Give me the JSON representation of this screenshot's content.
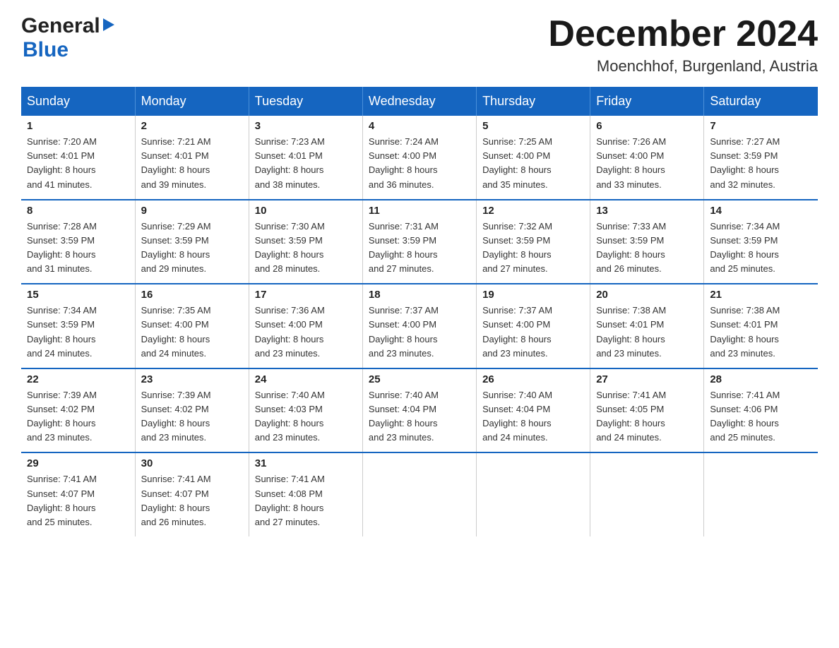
{
  "logo": {
    "line1": "General",
    "triangle": "▶",
    "line2": "Blue"
  },
  "title": "December 2024",
  "subtitle": "Moenchhof, Burgenland, Austria",
  "days_of_week": [
    "Sunday",
    "Monday",
    "Tuesday",
    "Wednesday",
    "Thursday",
    "Friday",
    "Saturday"
  ],
  "weeks": [
    [
      {
        "day": "1",
        "sunrise": "7:20 AM",
        "sunset": "4:01 PM",
        "daylight": "8 hours and 41 minutes."
      },
      {
        "day": "2",
        "sunrise": "7:21 AM",
        "sunset": "4:01 PM",
        "daylight": "8 hours and 39 minutes."
      },
      {
        "day": "3",
        "sunrise": "7:23 AM",
        "sunset": "4:01 PM",
        "daylight": "8 hours and 38 minutes."
      },
      {
        "day": "4",
        "sunrise": "7:24 AM",
        "sunset": "4:00 PM",
        "daylight": "8 hours and 36 minutes."
      },
      {
        "day": "5",
        "sunrise": "7:25 AM",
        "sunset": "4:00 PM",
        "daylight": "8 hours and 35 minutes."
      },
      {
        "day": "6",
        "sunrise": "7:26 AM",
        "sunset": "4:00 PM",
        "daylight": "8 hours and 33 minutes."
      },
      {
        "day": "7",
        "sunrise": "7:27 AM",
        "sunset": "3:59 PM",
        "daylight": "8 hours and 32 minutes."
      }
    ],
    [
      {
        "day": "8",
        "sunrise": "7:28 AM",
        "sunset": "3:59 PM",
        "daylight": "8 hours and 31 minutes."
      },
      {
        "day": "9",
        "sunrise": "7:29 AM",
        "sunset": "3:59 PM",
        "daylight": "8 hours and 29 minutes."
      },
      {
        "day": "10",
        "sunrise": "7:30 AM",
        "sunset": "3:59 PM",
        "daylight": "8 hours and 28 minutes."
      },
      {
        "day": "11",
        "sunrise": "7:31 AM",
        "sunset": "3:59 PM",
        "daylight": "8 hours and 27 minutes."
      },
      {
        "day": "12",
        "sunrise": "7:32 AM",
        "sunset": "3:59 PM",
        "daylight": "8 hours and 27 minutes."
      },
      {
        "day": "13",
        "sunrise": "7:33 AM",
        "sunset": "3:59 PM",
        "daylight": "8 hours and 26 minutes."
      },
      {
        "day": "14",
        "sunrise": "7:34 AM",
        "sunset": "3:59 PM",
        "daylight": "8 hours and 25 minutes."
      }
    ],
    [
      {
        "day": "15",
        "sunrise": "7:34 AM",
        "sunset": "3:59 PM",
        "daylight": "8 hours and 24 minutes."
      },
      {
        "day": "16",
        "sunrise": "7:35 AM",
        "sunset": "4:00 PM",
        "daylight": "8 hours and 24 minutes."
      },
      {
        "day": "17",
        "sunrise": "7:36 AM",
        "sunset": "4:00 PM",
        "daylight": "8 hours and 23 minutes."
      },
      {
        "day": "18",
        "sunrise": "7:37 AM",
        "sunset": "4:00 PM",
        "daylight": "8 hours and 23 minutes."
      },
      {
        "day": "19",
        "sunrise": "7:37 AM",
        "sunset": "4:00 PM",
        "daylight": "8 hours and 23 minutes."
      },
      {
        "day": "20",
        "sunrise": "7:38 AM",
        "sunset": "4:01 PM",
        "daylight": "8 hours and 23 minutes."
      },
      {
        "day": "21",
        "sunrise": "7:38 AM",
        "sunset": "4:01 PM",
        "daylight": "8 hours and 23 minutes."
      }
    ],
    [
      {
        "day": "22",
        "sunrise": "7:39 AM",
        "sunset": "4:02 PM",
        "daylight": "8 hours and 23 minutes."
      },
      {
        "day": "23",
        "sunrise": "7:39 AM",
        "sunset": "4:02 PM",
        "daylight": "8 hours and 23 minutes."
      },
      {
        "day": "24",
        "sunrise": "7:40 AM",
        "sunset": "4:03 PM",
        "daylight": "8 hours and 23 minutes."
      },
      {
        "day": "25",
        "sunrise": "7:40 AM",
        "sunset": "4:04 PM",
        "daylight": "8 hours and 23 minutes."
      },
      {
        "day": "26",
        "sunrise": "7:40 AM",
        "sunset": "4:04 PM",
        "daylight": "8 hours and 24 minutes."
      },
      {
        "day": "27",
        "sunrise": "7:41 AM",
        "sunset": "4:05 PM",
        "daylight": "8 hours and 24 minutes."
      },
      {
        "day": "28",
        "sunrise": "7:41 AM",
        "sunset": "4:06 PM",
        "daylight": "8 hours and 25 minutes."
      }
    ],
    [
      {
        "day": "29",
        "sunrise": "7:41 AM",
        "sunset": "4:07 PM",
        "daylight": "8 hours and 25 minutes."
      },
      {
        "day": "30",
        "sunrise": "7:41 AM",
        "sunset": "4:07 PM",
        "daylight": "8 hours and 26 minutes."
      },
      {
        "day": "31",
        "sunrise": "7:41 AM",
        "sunset": "4:08 PM",
        "daylight": "8 hours and 27 minutes."
      },
      null,
      null,
      null,
      null
    ]
  ]
}
